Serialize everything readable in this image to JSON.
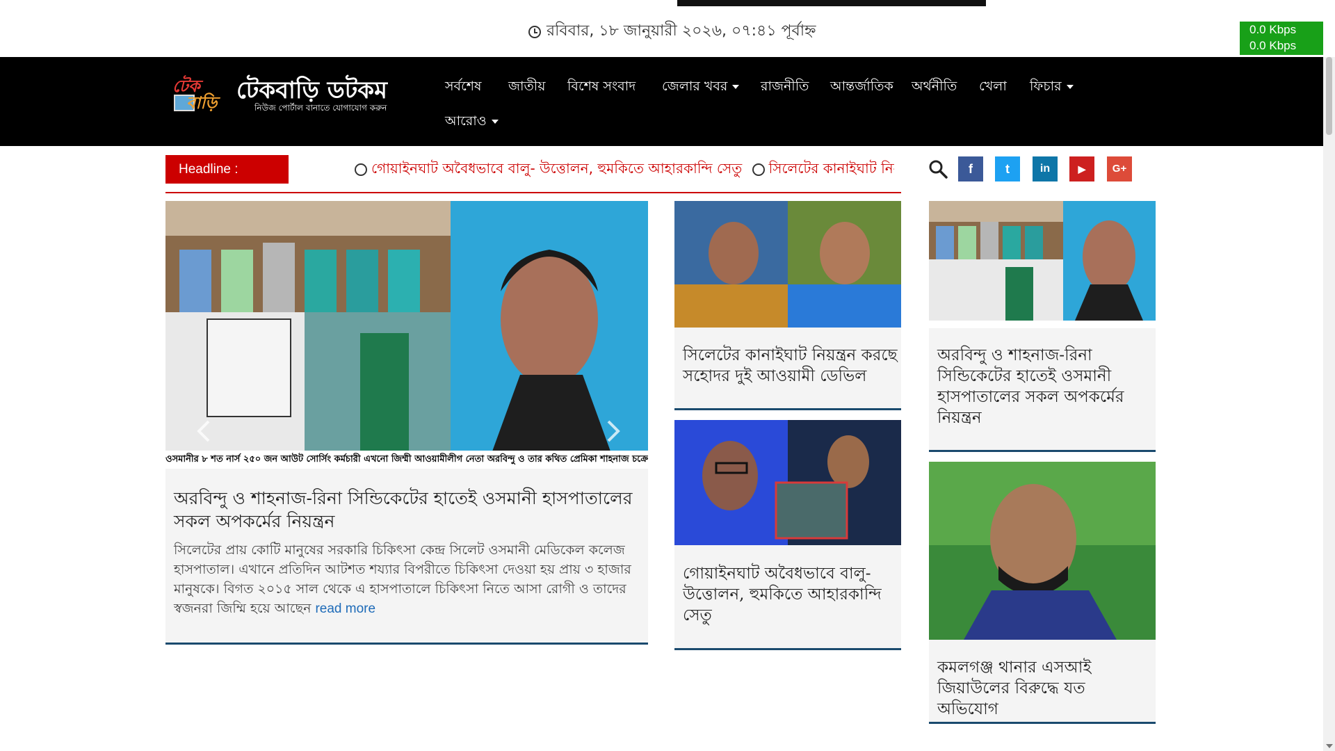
{
  "topbar": {
    "datetime": "রবিবার, ১৮ জানুয়ারী ২০২৬, ০৭:৪১ পূর্বাহ্ন",
    "speed_up": "0.0 Kbps",
    "speed_down": "0.0 Kbps"
  },
  "logo": {
    "badge_top": "টেক",
    "badge_bottom": "বাড়ি",
    "name": "টেকবাড়ি ডটকম",
    "tagline": "নিউজ পোর্টাল বানাতে যোগাযোগ করুন"
  },
  "nav": {
    "items": [
      {
        "label": "সর্বশেষ"
      },
      {
        "label": "জাতীয়"
      },
      {
        "label": "বিশেষ সংবাদ"
      },
      {
        "label": "জেলার খবর"
      },
      {
        "label": "রাজনীতি"
      },
      {
        "label": "আন্তর্জাতিক"
      },
      {
        "label": "অর্থনীতি"
      },
      {
        "label": "খেলা"
      },
      {
        "label": "ফিচার"
      },
      {
        "label": "আরোও"
      }
    ]
  },
  "headline": {
    "label": "Headline :",
    "ticker": "গোয়াইনঘাট অবৈধভাবে বালু- উত্তোলন, হুমকিতে আহারকান্দি সেতু",
    "ticker2": "সিলেটের কানাইঘাট নিয়ন্ত্রন"
  },
  "social": [
    {
      "icon": "facebook-icon",
      "glyph": "f",
      "color": "#3b5998"
    },
    {
      "icon": "twitter-icon",
      "glyph": "t",
      "color": "#1da1f2"
    },
    {
      "icon": "linkedin-icon",
      "glyph": "in",
      "color": "#0e76a8"
    },
    {
      "icon": "youtube-icon",
      "glyph": "▶",
      "color": "#cd201f"
    },
    {
      "icon": "google-plus-icon",
      "glyph": "G+",
      "color": "#dd4b39"
    }
  ],
  "main_story": {
    "caption": "ওসমানীর ৮ শত নার্স ২৫০ জন আউট সোর্সিং কর্মচারী এখনো জিম্মী আওয়ামীলীগ নেতা অরবিন্দু ও তার কথিত প্রেমিকা শাহনাজ চক্রের কাছে",
    "title": "অরবিন্দু ও শাহনাজ-রিনা সিন্ডিকেটের হাতেই ওসমানী হাসপাতালের সকল অপকর্মের নিয়ন্ত্রন",
    "excerpt": "সিলেটের প্রায় কোটি মানুষের সরকারি চিকিৎসা কেন্দ্র সিলেট ওসমানী মেডিকেল কলেজ হাসপাতাল। এখানে প্রতিদিন আটশত শয্যার বিপরীতে চিকিৎসা দেওয়া হয় প্রায় ৩ হাজার মানুষকে। বিগত ২০১৫ সাল থেকে এ হাসপাতালে চিকিৎসা নিতে আসা রোগী ও তাদের স্বজনরা জিম্মি হয়ে আছেন",
    "read_more": "read more"
  },
  "middle_stories": [
    {
      "title": "সিলেটের কানাইঘাট নিয়ন্ত্রন করছে সহোদর দুই আওয়ামী ডেভিল"
    },
    {
      "title": "গোয়াইনঘাট অবৈধভাবে বালু- উত্তোলন, হুমকিতে আহারকান্দি সেতু"
    }
  ],
  "right_stories": [
    {
      "title": "অরবিন্দু ও শাহনাজ-রিনা সিন্ডিকেটের হাতেই ওসমানী হাসপাতালের সকল অপকর্মের নিয়ন্ত্রন",
      "caption": "ওসমানীর ৮ শত নার্স ২৫০ জন আউট সোর্সিং কর্মচারী এখনো জিম্মী আওয়ামীলীগ নেতা অরবিন্দু ও তার কথিত প্রেমিকা শাহনাজ চক্রের কাছে"
    },
    {
      "title": "কমলগঞ্জ থানার এসআই জিয়াউলের বিরুদ্ধে যত অভিযোগ"
    }
  ]
}
